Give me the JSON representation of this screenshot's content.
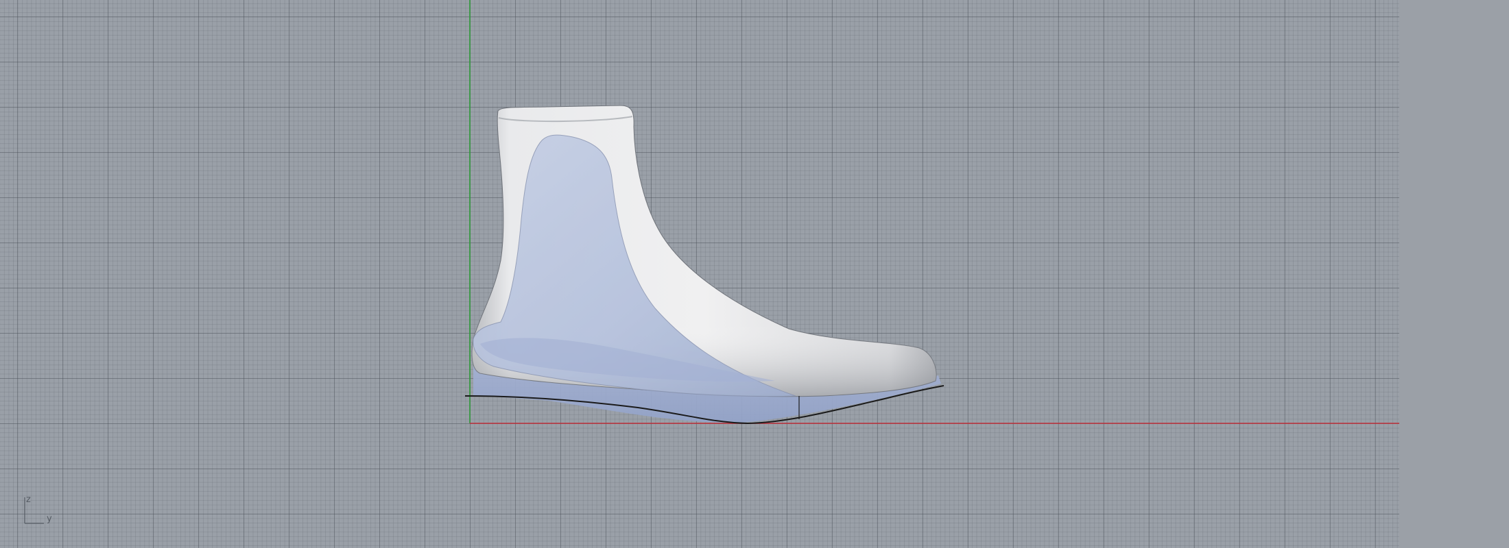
{
  "viewport": {
    "view": "Right",
    "background_color": "#9aa0a8",
    "grid_major_color": "#6a7079",
    "grid_minor_color": "#8b9099"
  },
  "axes": {
    "x_axis_color": "#c0303a",
    "y_axis_color": "#2f9a3a"
  },
  "model": {
    "name": "ankle-boot-last",
    "shoe_body_color": "#e4e5e7",
    "shoe_shadow_color": "#8e9197",
    "inner_last_color": "#b5c2de",
    "sole_line_color": "#1a1a1a"
  },
  "axis_gizmo": {
    "z_label": "z",
    "y_label": "y"
  }
}
